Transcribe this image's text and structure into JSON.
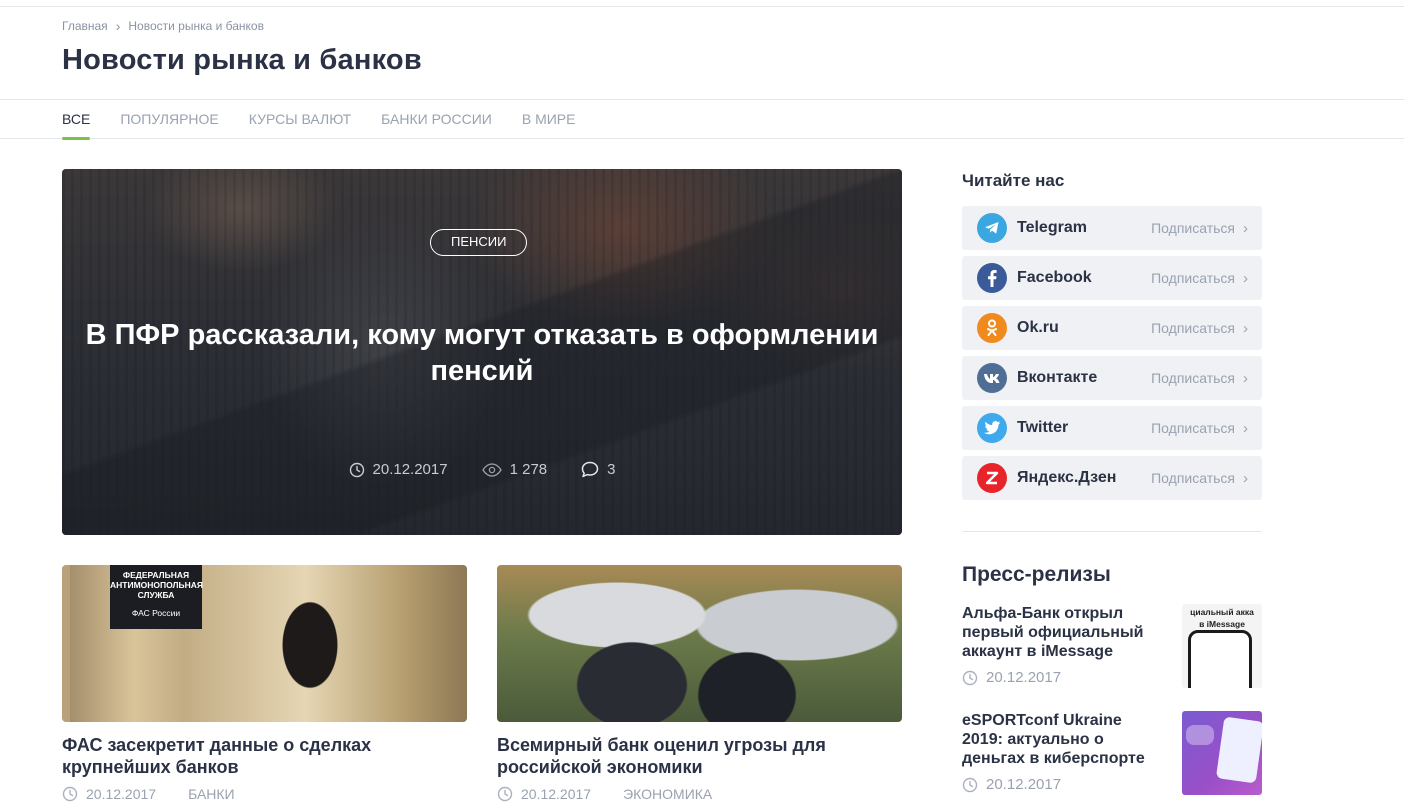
{
  "breadcrumb": {
    "home": "Главная",
    "current": "Новости рынка и банков"
  },
  "page_title": "Новости рынка и банков",
  "tabs": [
    {
      "label": "ВСЕ",
      "active": true
    },
    {
      "label": "ПОПУЛЯРНОЕ",
      "active": false
    },
    {
      "label": "КУРСЫ ВАЛЮТ",
      "active": false
    },
    {
      "label": "БАНКИ РОССИИ",
      "active": false
    },
    {
      "label": "В МИРЕ",
      "active": false
    }
  ],
  "hero": {
    "tag": "ПЕНСИИ",
    "title": "В ПФР рассказали, кому могут отказать в оформлении пенсий",
    "date": "20.12.2017",
    "views": "1 278",
    "comments": "3"
  },
  "cards": [
    {
      "image_text_line1": "ФЕДЕРАЛЬНАЯ",
      "image_text_line2": "АНТИМОНОПОЛЬНАЯ",
      "image_text_line3": "СЛУЖБА",
      "image_text_line4": "ФАС России",
      "title": "ФАС засекретит данные о сделках крупнейших банков",
      "date": "20.12.2017",
      "category": "БАНКИ"
    },
    {
      "title": "Всемирный банк оценил угрозы для российской экономики",
      "date": "20.12.2017",
      "category": "ЭКОНОМИКА"
    }
  ],
  "sidebar": {
    "follow_title": "Читайте нас",
    "socials": [
      {
        "name": "Telegram",
        "action": "Подписаться",
        "icon": "telegram-icon",
        "color": "#3aa7e0"
      },
      {
        "name": "Facebook",
        "action": "Подписаться",
        "icon": "facebook-icon",
        "color": "#3b5a9a"
      },
      {
        "name": "Ok.ru",
        "action": "Подписаться",
        "icon": "odnoklassniki-icon",
        "color": "#f08a1c"
      },
      {
        "name": "Вконтакте",
        "action": "Подписаться",
        "icon": "vk-icon",
        "color": "#4f6e95"
      },
      {
        "name": "Twitter",
        "action": "Подписаться",
        "icon": "twitter-icon",
        "color": "#3fa9ee"
      },
      {
        "name": "Яндекс.Дзен",
        "action": "Подписаться",
        "icon": "yandex-zen-icon",
        "color": "#e8232a"
      }
    ],
    "press_title": "Пресс-релизы",
    "press": [
      {
        "title": "Альфа-Банк открыл первый официальный аккаунт в iMessage",
        "date": "20.12.2017",
        "thumb_caption1": "циальный акка",
        "thumb_caption2": "в iMessage"
      },
      {
        "title": "eSPORTconf Ukraine 2019: актуально о деньгах в киберспорте",
        "date": "20.12.2017"
      }
    ]
  },
  "colors": {
    "accent": "#7cc04b",
    "text": "#2b3245",
    "muted": "#9aa2b0",
    "row_bg": "#eff1f4"
  }
}
